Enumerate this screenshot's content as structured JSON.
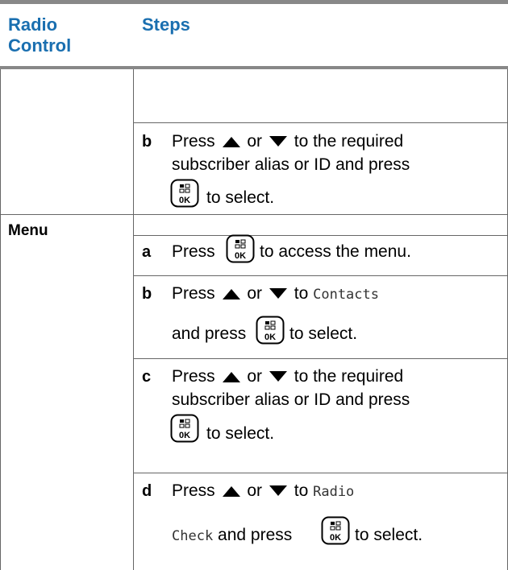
{
  "header": {
    "col1": "Radio\nControl",
    "col2": "Steps"
  },
  "rows": [
    {
      "label": "",
      "steps": [
        {
          "letter": "b",
          "line1": [
            "Press",
            "or",
            "to the required"
          ],
          "line2": "subscriber alias or ID and press",
          "line3_after": "to select."
        }
      ]
    },
    {
      "label": "Menu",
      "steps": [
        {
          "letter": "a",
          "line1_before": "Press",
          "line1_after": "to access the menu."
        },
        {
          "letter": "b",
          "line1": [
            "Press",
            "or",
            "to"
          ],
          "code1": "Contacts",
          "line2_before": "and press",
          "line2_after": "to select."
        },
        {
          "letter": "c",
          "line1": [
            "Press",
            "or",
            "to the required"
          ],
          "line2": "subscriber alias or ID and press",
          "line3_after": "to select."
        },
        {
          "letter": "d",
          "line1": [
            "Press",
            "or",
            "to"
          ],
          "code1": "Radio",
          "code2": "Check",
          "line2_after": "and press",
          "line2_after2": "to select."
        }
      ]
    }
  ],
  "icons": {
    "up": "up-arrow-icon",
    "down": "down-arrow-icon",
    "ok": "menu-ok-key-icon"
  }
}
